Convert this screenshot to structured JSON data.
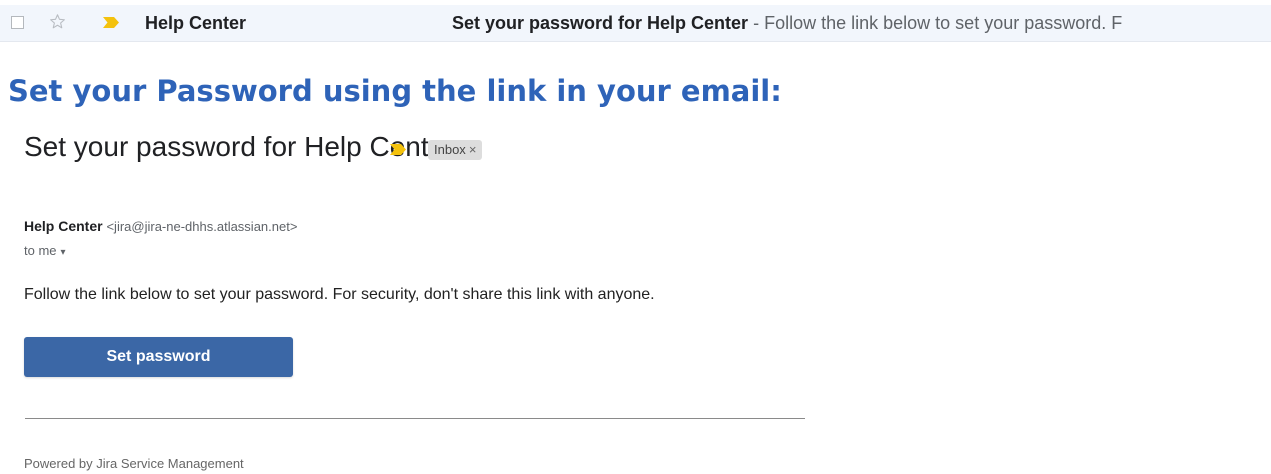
{
  "inbox_row": {
    "sender": "Help Center",
    "subject": "Set your password for Help Center",
    "separator": "-",
    "snippet": "Follow the link below to set your password. F",
    "icons": [
      "checkbox-icon",
      "star-icon",
      "importance-marker-icon"
    ]
  },
  "instruction": "Set your Password using the link in your email:",
  "email": {
    "subject": "Set your password for Help Center",
    "label": "Inbox",
    "label_remove": "×",
    "from_name": "Help Center",
    "from_email": "<jira@jira-ne-dhhs.atlassian.net>",
    "to": "to me",
    "to_caret": "▾",
    "body": "Follow the link below to set your password. For security, don't share this link with anyone.",
    "button_label": "Set password",
    "footer": "Powered by Jira Service Management"
  },
  "colors": {
    "instruction": "#2e63b8",
    "button": "#3b67a6",
    "importance_marker": "#f4c20d",
    "inbox_row_background": "#f2f6fc"
  }
}
